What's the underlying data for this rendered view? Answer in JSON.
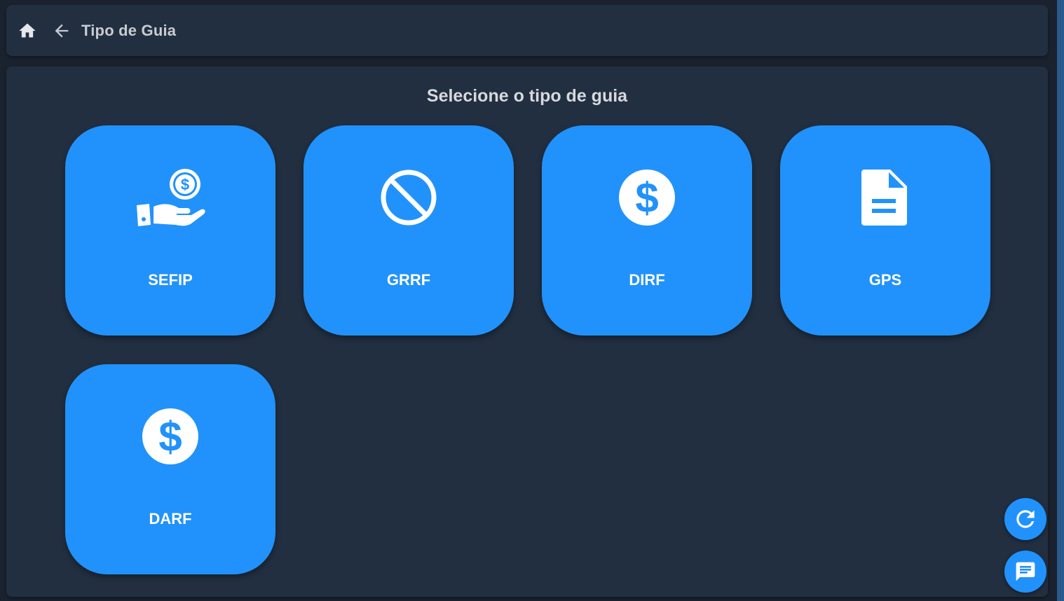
{
  "header": {
    "title": "Tipo de Guia",
    "home_icon": "home-icon",
    "back_icon": "arrow-back-icon"
  },
  "main": {
    "heading": "Selecione o tipo de guia",
    "tiles": [
      {
        "label": "SEFIP",
        "icon": "hand-coin-icon"
      },
      {
        "label": "GRRF",
        "icon": "block-icon"
      },
      {
        "label": "DIRF",
        "icon": "dollar-circle-icon"
      },
      {
        "label": "GPS",
        "icon": "document-icon"
      },
      {
        "label": "DARF",
        "icon": "dollar-circle-icon"
      }
    ]
  },
  "fabs": {
    "refresh_icon": "refresh-icon",
    "chat_icon": "chat-icon"
  },
  "colors": {
    "background": "#19222e",
    "panel": "#222f40",
    "accent": "#2192fb",
    "text": "#d6d9de"
  }
}
